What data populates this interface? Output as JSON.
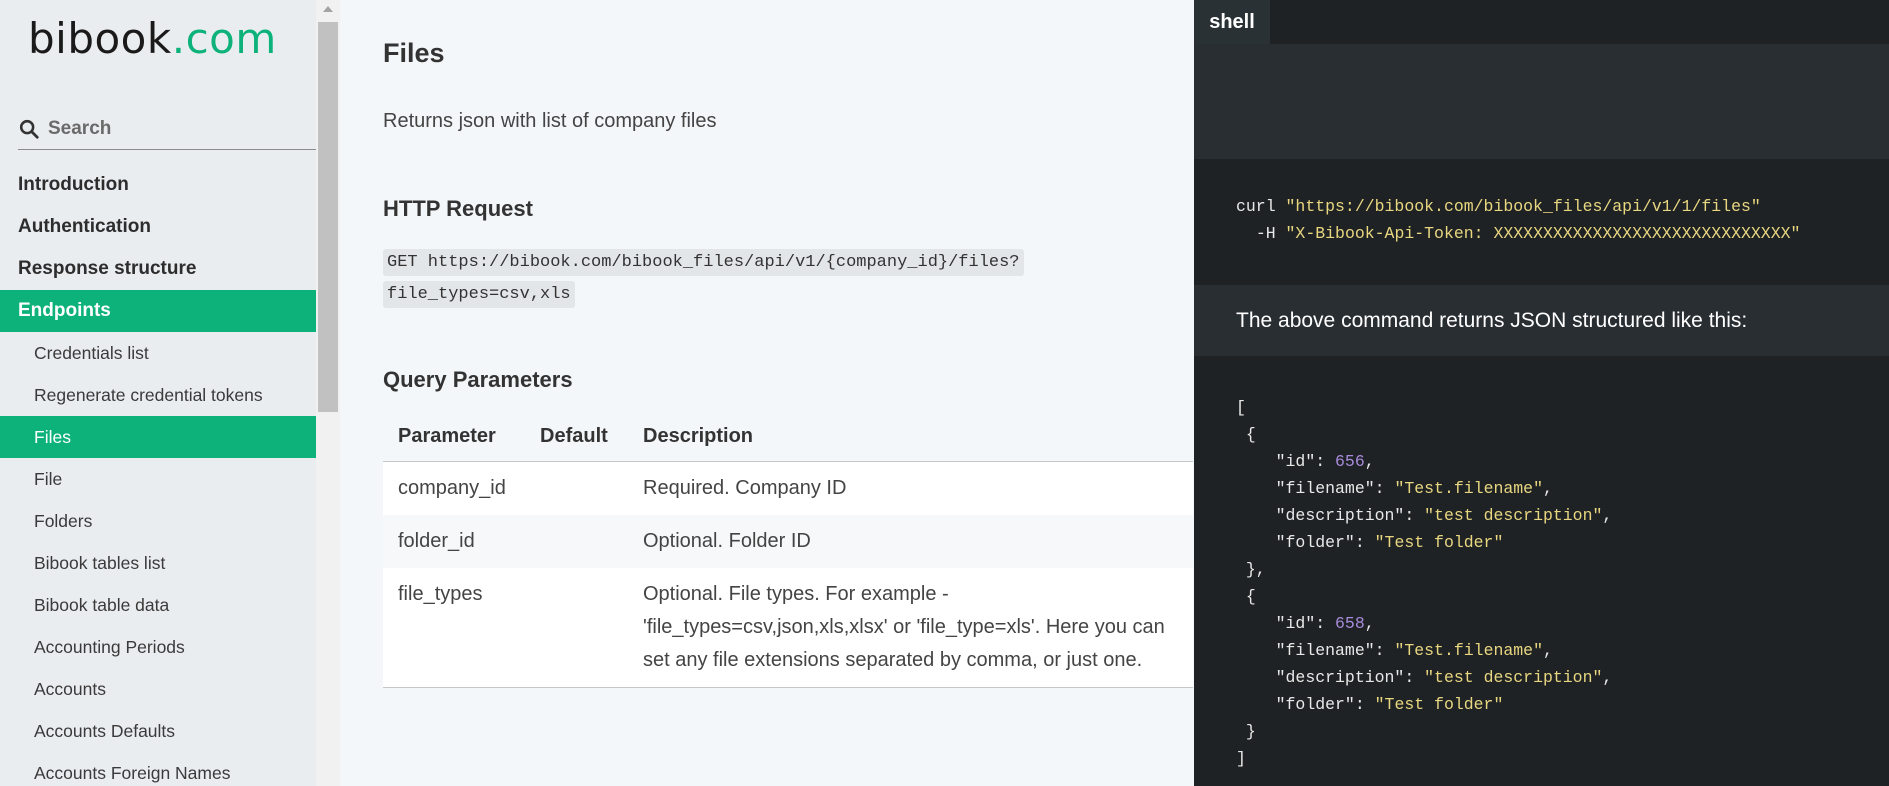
{
  "brand": {
    "name_main": "bibook",
    "name_accent": ".com",
    "accent_color": "#0db27a"
  },
  "search": {
    "placeholder": "Search"
  },
  "nav": [
    {
      "label": "Introduction",
      "level": "top",
      "active": false
    },
    {
      "label": "Authentication",
      "level": "top",
      "active": false
    },
    {
      "label": "Response structure",
      "level": "top",
      "active": false
    },
    {
      "label": "Endpoints",
      "level": "top",
      "active": true
    },
    {
      "label": "Credentials list",
      "level": "sub",
      "active": false
    },
    {
      "label": "Regenerate credential tokens",
      "level": "sub",
      "active": false
    },
    {
      "label": "Files",
      "level": "sub",
      "active": true
    },
    {
      "label": "File",
      "level": "sub",
      "active": false
    },
    {
      "label": "Folders",
      "level": "sub",
      "active": false
    },
    {
      "label": "Bibook tables list",
      "level": "sub",
      "active": false
    },
    {
      "label": "Bibook table data",
      "level": "sub",
      "active": false
    },
    {
      "label": "Accounting Periods",
      "level": "sub",
      "active": false
    },
    {
      "label": "Accounts",
      "level": "sub",
      "active": false
    },
    {
      "label": "Accounts Defaults",
      "level": "sub",
      "active": false
    },
    {
      "label": "Accounts Foreign Names",
      "level": "sub",
      "active": false
    }
  ],
  "main": {
    "title": "Files",
    "description": "Returns json with list of company files",
    "http_heading": "HTTP Request",
    "http_request": "GET https://bibook.com/bibook_files/api/v1/{company_id}/files?file_types=csv,xls",
    "query_heading": "Query Parameters",
    "table": {
      "headers": [
        "Parameter",
        "Default",
        "Description"
      ],
      "rows": [
        [
          "company_id",
          "",
          "Required. Company ID"
        ],
        [
          "folder_id",
          "",
          "Optional. Folder ID"
        ],
        [
          "file_types",
          "",
          "Optional. File types. For example - 'file_types=csv,json,xls,xlsx' or 'file_type=xls'. Here you can set any file extensions separated by comma, or just one."
        ]
      ]
    }
  },
  "code": {
    "tab": "shell",
    "curl_cmd": "curl",
    "curl_url": "\"https://bibook.com/bibook_files/api/v1/1/files\"",
    "header_flag": "-H",
    "header_value": "\"X-Bibook-Api-Token: XXXXXXXXXXXXXXXXXXXXXXXXXXXXXX\"",
    "returns_text": "The above command returns JSON structured like this:",
    "json_items": [
      {
        "id": 656,
        "filename": "Test.filename",
        "description": "test description",
        "folder": "Test folder"
      },
      {
        "id": 658,
        "filename": "Test.filename",
        "description": "test description",
        "folder": "Test folder"
      }
    ]
  }
}
